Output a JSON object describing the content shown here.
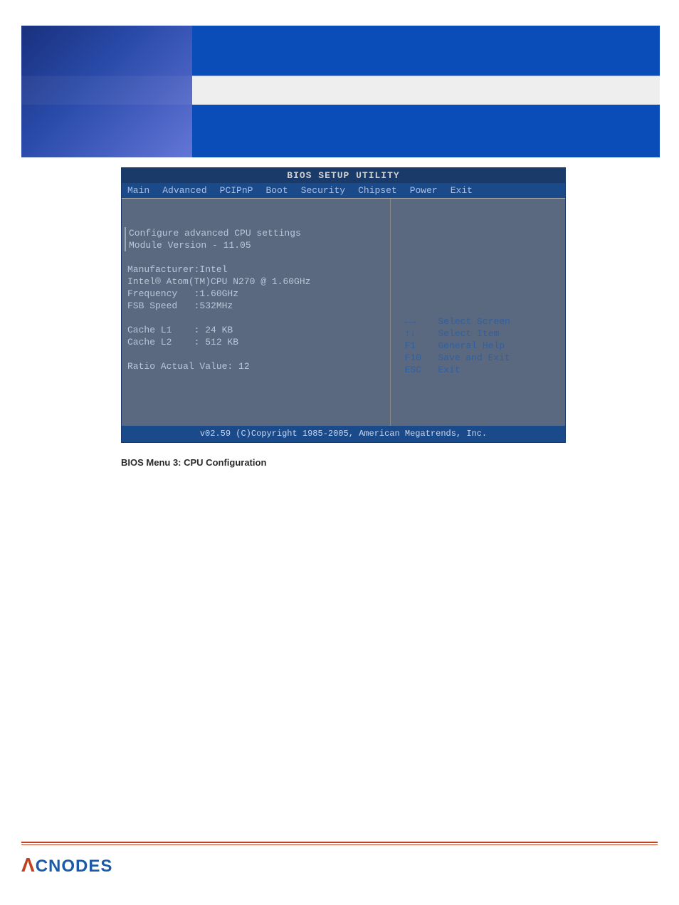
{
  "bios": {
    "title": "BIOS SETUP UTILITY",
    "menu": {
      "main": "Main",
      "advanced": "Advanced",
      "pcipnp": "PCIPnP",
      "boot": "Boot",
      "security": "Security",
      "chipset": "Chipset",
      "power": "Power",
      "exit": "Exit"
    },
    "left": {
      "line1": "Configure advanced CPU settings",
      "line2": "Module Version - 11.05",
      "manufacturer": "Manufacturer:Intel",
      "cpu": "Intel® Atom(TM)CPU N270 @ 1.60GHz",
      "frequency": "Frequency   :1.60GHz",
      "fsb": "FSB Speed   :532MHz",
      "cachel1": "Cache L1    : 24 KB",
      "cachel2": "Cache L2    : 512 KB",
      "ratio": "Ratio Actual Value: 12"
    },
    "help": {
      "k1": "←→",
      "v1": "Select Screen",
      "k2": "↑↓",
      "v2": "Select Item",
      "k3": "F1",
      "v3": "General Help",
      "k4": "F10",
      "v4": "Save and Exit",
      "k5": "ESC",
      "v5": "Exit"
    },
    "footer": "v02.59 (C)Copyright 1985-2005, American Megatrends, Inc."
  },
  "caption": "BIOS Menu 3: CPU Configuration",
  "logo": "CNODES"
}
